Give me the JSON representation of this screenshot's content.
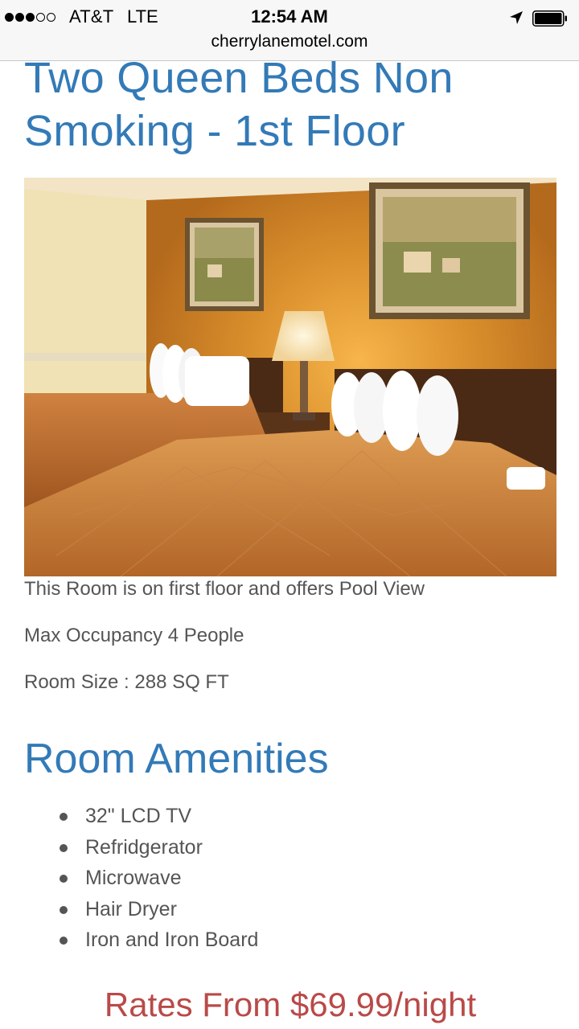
{
  "status_bar": {
    "carrier": "AT&T",
    "network": "LTE",
    "time": "12:54 AM",
    "signal_bars": 3,
    "signal_total": 5,
    "url": "cherrylanemotel.com"
  },
  "room": {
    "title": "Two Queen Beds Non Smoking - 1st Floor",
    "photo_alt": "Room with two queen beds",
    "descriptions": [
      "This Room is on first floor and offers Pool View",
      "Max Occupancy 4 People",
      "Room Size : 288 SQ FT"
    ]
  },
  "amenities": {
    "heading": "Room Amenities",
    "items": [
      "32\" LCD TV",
      "Refridgerator",
      "Microwave",
      "Hair Dryer",
      "Iron and Iron Board"
    ]
  },
  "rates": {
    "text": "Rates From $69.99/night"
  },
  "colors": {
    "heading_blue": "#337ab7",
    "body_gray": "#555555",
    "rates_red": "#b94a48"
  }
}
